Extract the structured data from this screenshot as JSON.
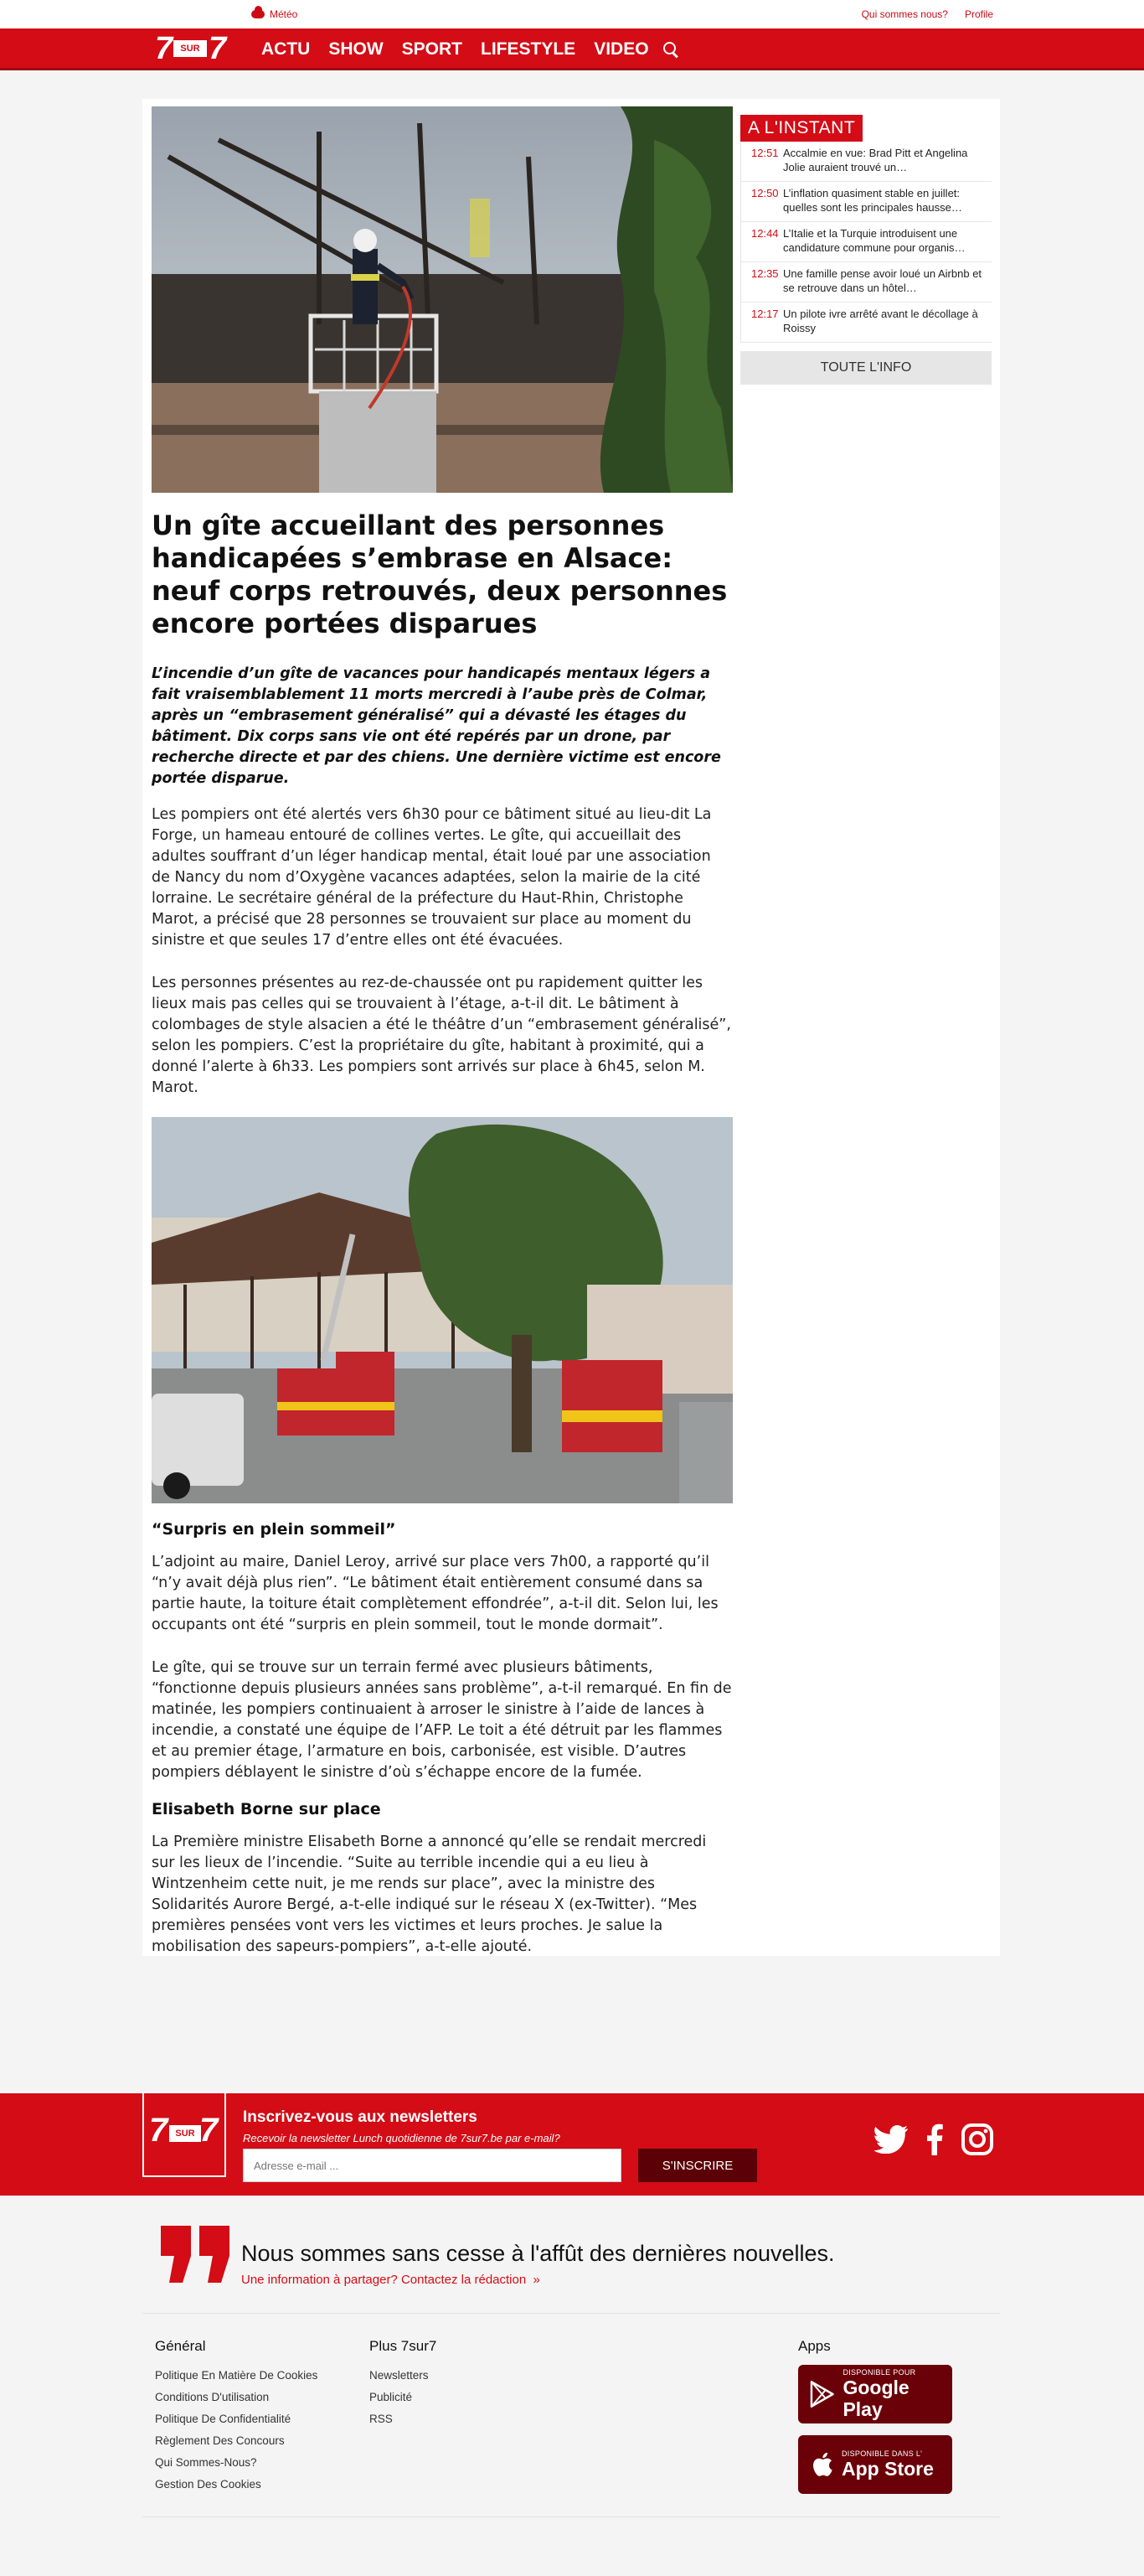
{
  "utility": {
    "meteo": "Météo",
    "links": [
      "Qui sommes nous?",
      "Profile"
    ]
  },
  "logo": {
    "left": "7",
    "middle": "SUR",
    "right": "7"
  },
  "nav": {
    "items": [
      "ACTU",
      "SHOW",
      "SPORT",
      "LIFESTYLE",
      "VIDEO"
    ]
  },
  "article": {
    "headline": "Un gîte accueillant des personnes handicapées s’embrase en Alsace: neuf corps retrouvés, deux personnes encore portées disparues",
    "lead": "L’incendie d’un gîte de vacances pour handicapés mentaux légers a fait vraisemblablement 11 morts mercredi à l’aube près de Colmar, après un “embrasement généralisé” qui a dévasté les étages du bâtiment. Dix corps sans vie ont été repérés par un drone, par recherche directe et par des chiens. Une dernière victime est encore portée disparue.",
    "p1": "Les pompiers ont été alertés vers 6h30 pour ce bâtiment situé au lieu-dit La Forge, un hameau entouré de collines vertes. Le gîte, qui accueillait des adultes souffrant d’un léger handicap mental, était loué par une association de Nancy du nom d’Oxygène vacances adaptées, selon la mairie de la cité lorraine. Le secrétaire général de la préfecture du Haut-Rhin, Christophe Marot, a précisé que 28 personnes se trouvaient sur place au moment du sinistre et que seules 17 d’entre elles ont été évacuées.",
    "p2": "Les personnes présentes au rez-de-chaussée ont pu rapidement quitter les lieux mais pas celles qui se trouvaient à l’étage, a-t-il dit. Le bâtiment à colombages de style alsacien a été le théâtre d’un “embrasement généralisé”, selon les pompiers. C’est la propriétaire du gîte, habitant à proximité, qui a donné l’alerte à 6h33. Les pompiers sont arrivés sur place à 6h45, selon M. Marot.",
    "sub1": "“Surpris en plein sommeil”",
    "p3": "L’adjoint au maire, Daniel Leroy, arrivé sur place vers 7h00, a rapporté qu’il “n’y avait déjà plus rien”. “Le bâtiment était entièrement consumé dans sa partie haute, la toiture était complètement effondrée”, a-t-il dit. Selon lui, les occupants ont été “surpris en plein sommeil, tout le monde dormait”.",
    "p4": "Le gîte, qui se trouve sur un terrain fermé avec plusieurs bâtiments, “fonctionne depuis plusieurs années sans problème”, a-t-il remarqué. En fin de matinée, les pompiers continuaient à arroser le sinistre à l’aide de lances à incendie, a constaté une équipe de l’AFP. Le toit a été détruit par les flammes et au premier étage, l’armature en bois, carbonisée, est visible. D’autres pompiers déblayent le sinistre d’où s’échappe encore de la fumée.",
    "sub2": "Elisabeth Borne sur place",
    "p5": "La Première ministre Elisabeth Borne a annoncé qu’elle se rendait mercredi sur les lieux de l’incendie. “Suite au terrible incendie qui a eu lieu à Wintzenheim cette nuit, je me rends sur place”, avec la ministre des Solidarités Aurore Bergé, a-t-elle indiqué sur le réseau X (ex-Twitter). “Mes premières pensées vont vers les victimes et leurs proches. Je salue la mobilisation des sapeurs-pompiers”, a-t-elle ajouté."
  },
  "sidebar": {
    "title": "A L'INSTANT",
    "items": [
      {
        "time": "12:51",
        "text": "Accalmie en vue: Brad Pitt et Angelina Jolie auraient trouvé un…"
      },
      {
        "time": "12:50",
        "text": "L’inflation quasiment stable en juillet: quelles sont les principales hausse…"
      },
      {
        "time": "12:44",
        "text": "L’Italie et la Turquie introduisent une candidature commune pour organis…"
      },
      {
        "time": "12:35",
        "text": "Une famille pense avoir loué un Airbnb et se retrouve dans un hôtel…"
      },
      {
        "time": "12:17",
        "text": "Un pilote ivre arrêté avant le décollage à Roissy"
      }
    ],
    "button": "TOUTE L'INFO"
  },
  "newsletter": {
    "title": "Inscrivez-vous aux newsletters",
    "subtitle": "Recevoir la newsletter Lunch quotidienne de 7sur7.be par e-mail?",
    "placeholder": "Adresse e-mail ...",
    "button": "S'INSCRIRE"
  },
  "quote": {
    "title": "Nous sommes sans cesse à l'affût des dernières nouvelles.",
    "link": "Une information à partager? Contactez la rédaction"
  },
  "footer": {
    "general": {
      "heading": "Général",
      "links": [
        "Politique En Matière De Cookies",
        "Conditions D'utilisation",
        "Politique De Confidentialité",
        "Règlement Des Concours",
        "Qui Sommes-Nous?",
        "Gestion Des Cookies"
      ]
    },
    "plus": {
      "heading": "Plus 7sur7",
      "links": [
        "Newsletters",
        "Publicité",
        "RSS"
      ]
    },
    "apps": {
      "heading": "Apps",
      "google_small": "DISPONIBLE POUR",
      "google_big": "Google Play",
      "apple_small": "DISPONIBLE DANS L'",
      "apple_big": "App Store"
    }
  },
  "colors": {
    "brand": "#d30c16",
    "dark_red": "#5b0006"
  }
}
